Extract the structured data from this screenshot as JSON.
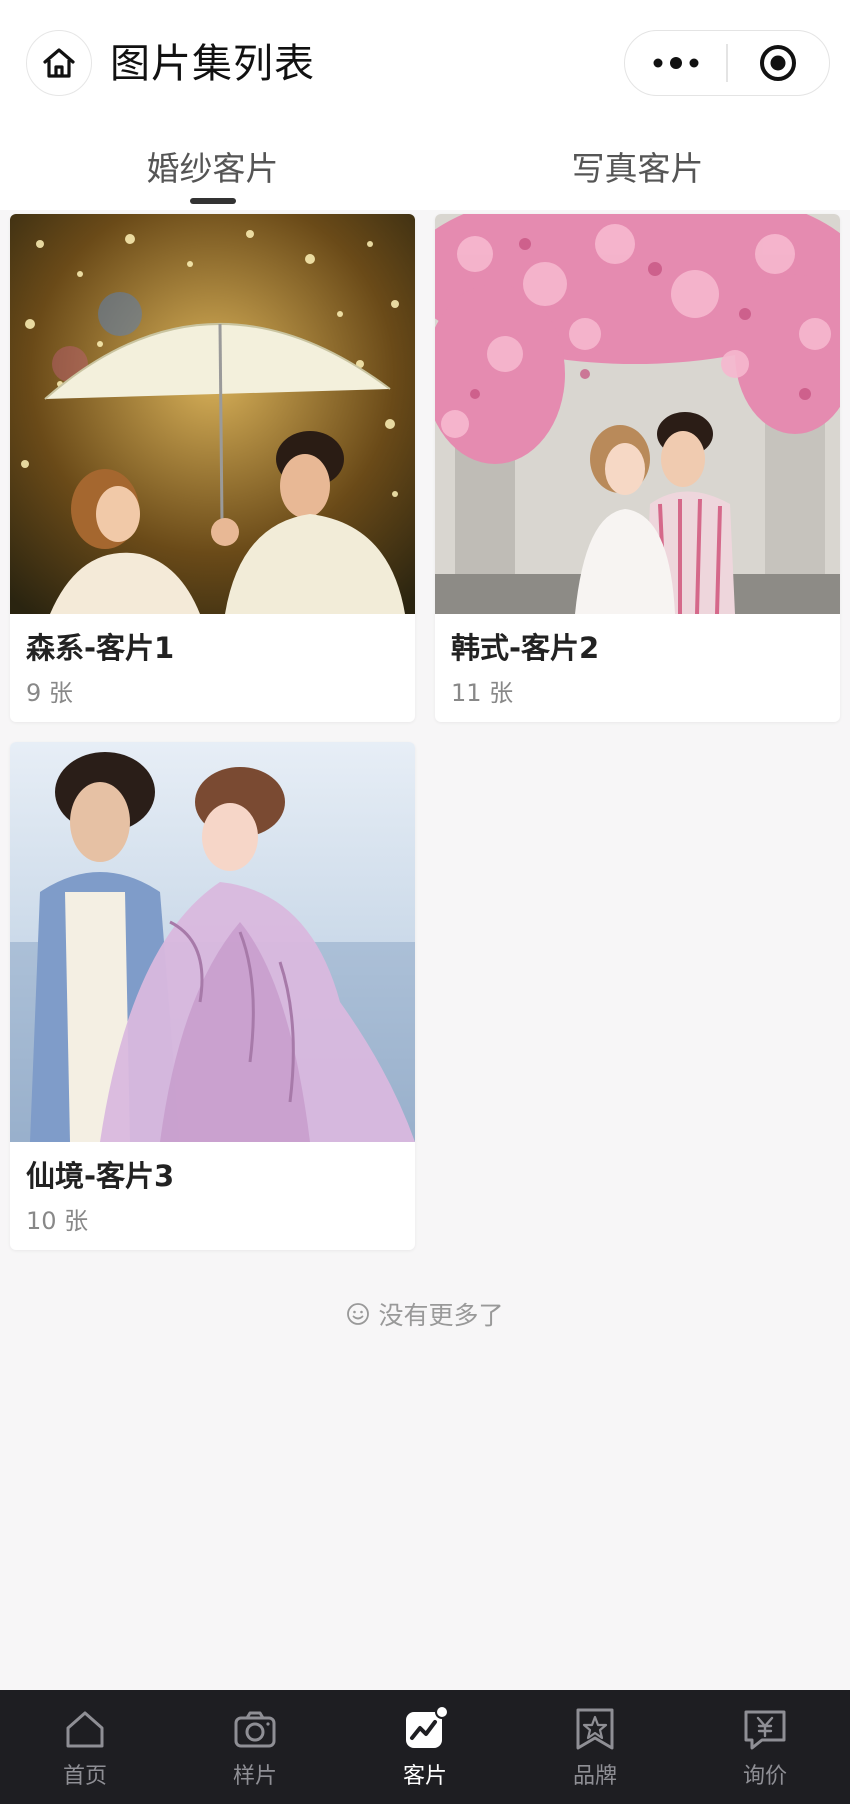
{
  "header": {
    "title": "图片集列表"
  },
  "tabs": [
    {
      "label": "婚纱客片",
      "active": true
    },
    {
      "label": "写真客片",
      "active": false
    }
  ],
  "albums": [
    {
      "title": "森系-客片1",
      "count": "9 张",
      "photo": "couple under umbrella with bokeh lights"
    },
    {
      "title": "韩式-客片2",
      "count": "11 张",
      "photo": "couple under pink blossom tree"
    },
    {
      "title": "仙境-客片3",
      "count": "10 张",
      "photo": "couple in lilac dress by sea"
    }
  ],
  "end_note": "没有更多了",
  "tabbar": [
    {
      "label": "首页",
      "icon": "home-icon",
      "active": false
    },
    {
      "label": "样片",
      "icon": "camera-icon",
      "active": false
    },
    {
      "label": "客片",
      "icon": "chart-icon",
      "active": true
    },
    {
      "label": "品牌",
      "icon": "star-icon",
      "active": false
    },
    {
      "label": "询价",
      "icon": "price-icon",
      "active": false
    }
  ],
  "colors": {
    "background": "#f7f6f7",
    "tabbar_bg": "#1e1e22",
    "tabbar_inactive": "#8f8f95",
    "tabbar_active": "#ffffff"
  }
}
